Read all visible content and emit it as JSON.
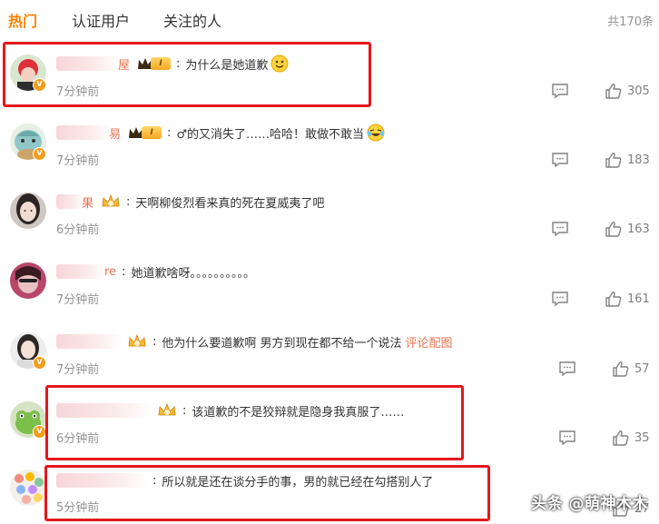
{
  "tabs": [
    {
      "label": "热门"
    },
    {
      "label": "认证用户"
    },
    {
      "label": "关注的人"
    }
  ],
  "total": "共170条",
  "colors": {
    "accent": "#ff8200",
    "link": "#eb7350",
    "highlight_box": "#e5171d",
    "muted": "#939393"
  },
  "comments": [
    {
      "name_tail": "屋",
      "level": "I",
      "text": "为什么是她道歉",
      "emoji": "smile-emoji",
      "link": "",
      "time": "7分钟前",
      "likes": "305"
    },
    {
      "name_tail": "易",
      "level": "I",
      "text": "♂的又消失了……哈哈！敢做不敢当",
      "emoji": "laugh-cry-emoji",
      "link": "",
      "time": "7分钟前",
      "likes": "183"
    },
    {
      "name_tail": "果",
      "level": "",
      "text": "天啊柳俊烈看来真的死在夏威夷了吧",
      "emoji": "",
      "link": "",
      "time": "6分钟前",
      "likes": "163"
    },
    {
      "name_tail": "re",
      "level": "",
      "text": "她道歉啥呀。。。。。。。。。。",
      "emoji": "",
      "link": "",
      "time": "7分钟前",
      "likes": "161"
    },
    {
      "name_tail": "",
      "level": "",
      "text": "他为什么要道歉啊 男方到现在都不给一个说法",
      "emoji": "",
      "link": "评论配图",
      "time": "7分钟前",
      "likes": "57"
    },
    {
      "name_tail": "",
      "level": "",
      "text": "该道歉的不是狡辩就是隐身我真服了……",
      "emoji": "",
      "link": "",
      "time": "6分钟前",
      "likes": "35"
    },
    {
      "name_tail": "",
      "level": "",
      "text": "所以就是还在谈分手的事，男的就已经在勾搭别人了",
      "emoji": "",
      "link": "",
      "time": "5分钟前",
      "likes": "27"
    }
  ],
  "watermark": "头条 @萌神木木"
}
